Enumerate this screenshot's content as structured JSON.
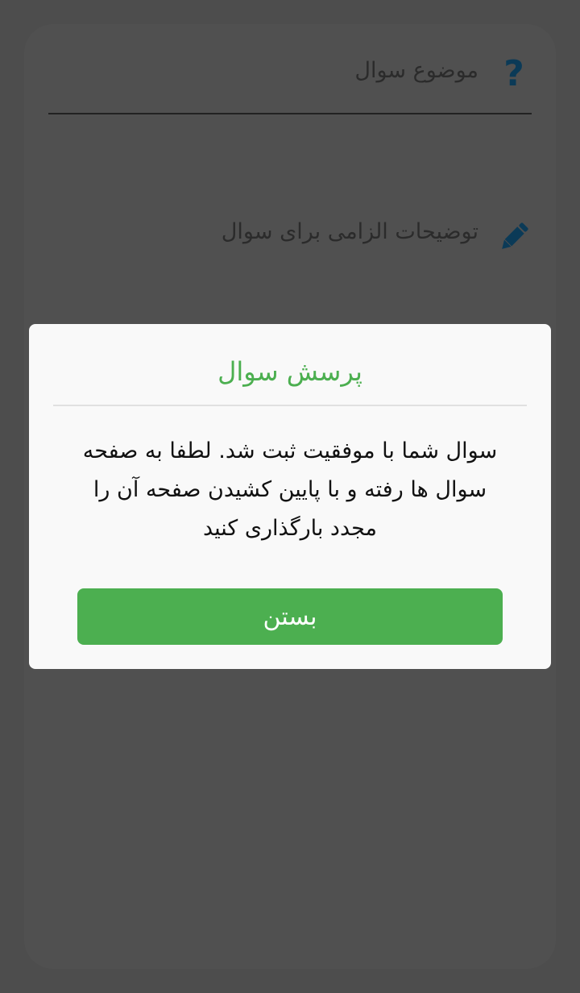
{
  "form": {
    "subject_label": "موضوع سوال",
    "subject_icon": "question-mark-icon",
    "description_label": "توضیحات الزامی برای سوال",
    "description_icon": "pencil-icon",
    "icon_color": "#0b3a57"
  },
  "dialog": {
    "title": "پرسش سوال",
    "message_lines": [
      "سوال شما با موفقیت ثبت شد. لطفا به صفحه",
      "سوال ها رفته و با پایین کشیدن صفحه آن را",
      "مجدد بارگذاری کنید"
    ],
    "close_label": "بستن",
    "accent_color": "#4caf50"
  }
}
